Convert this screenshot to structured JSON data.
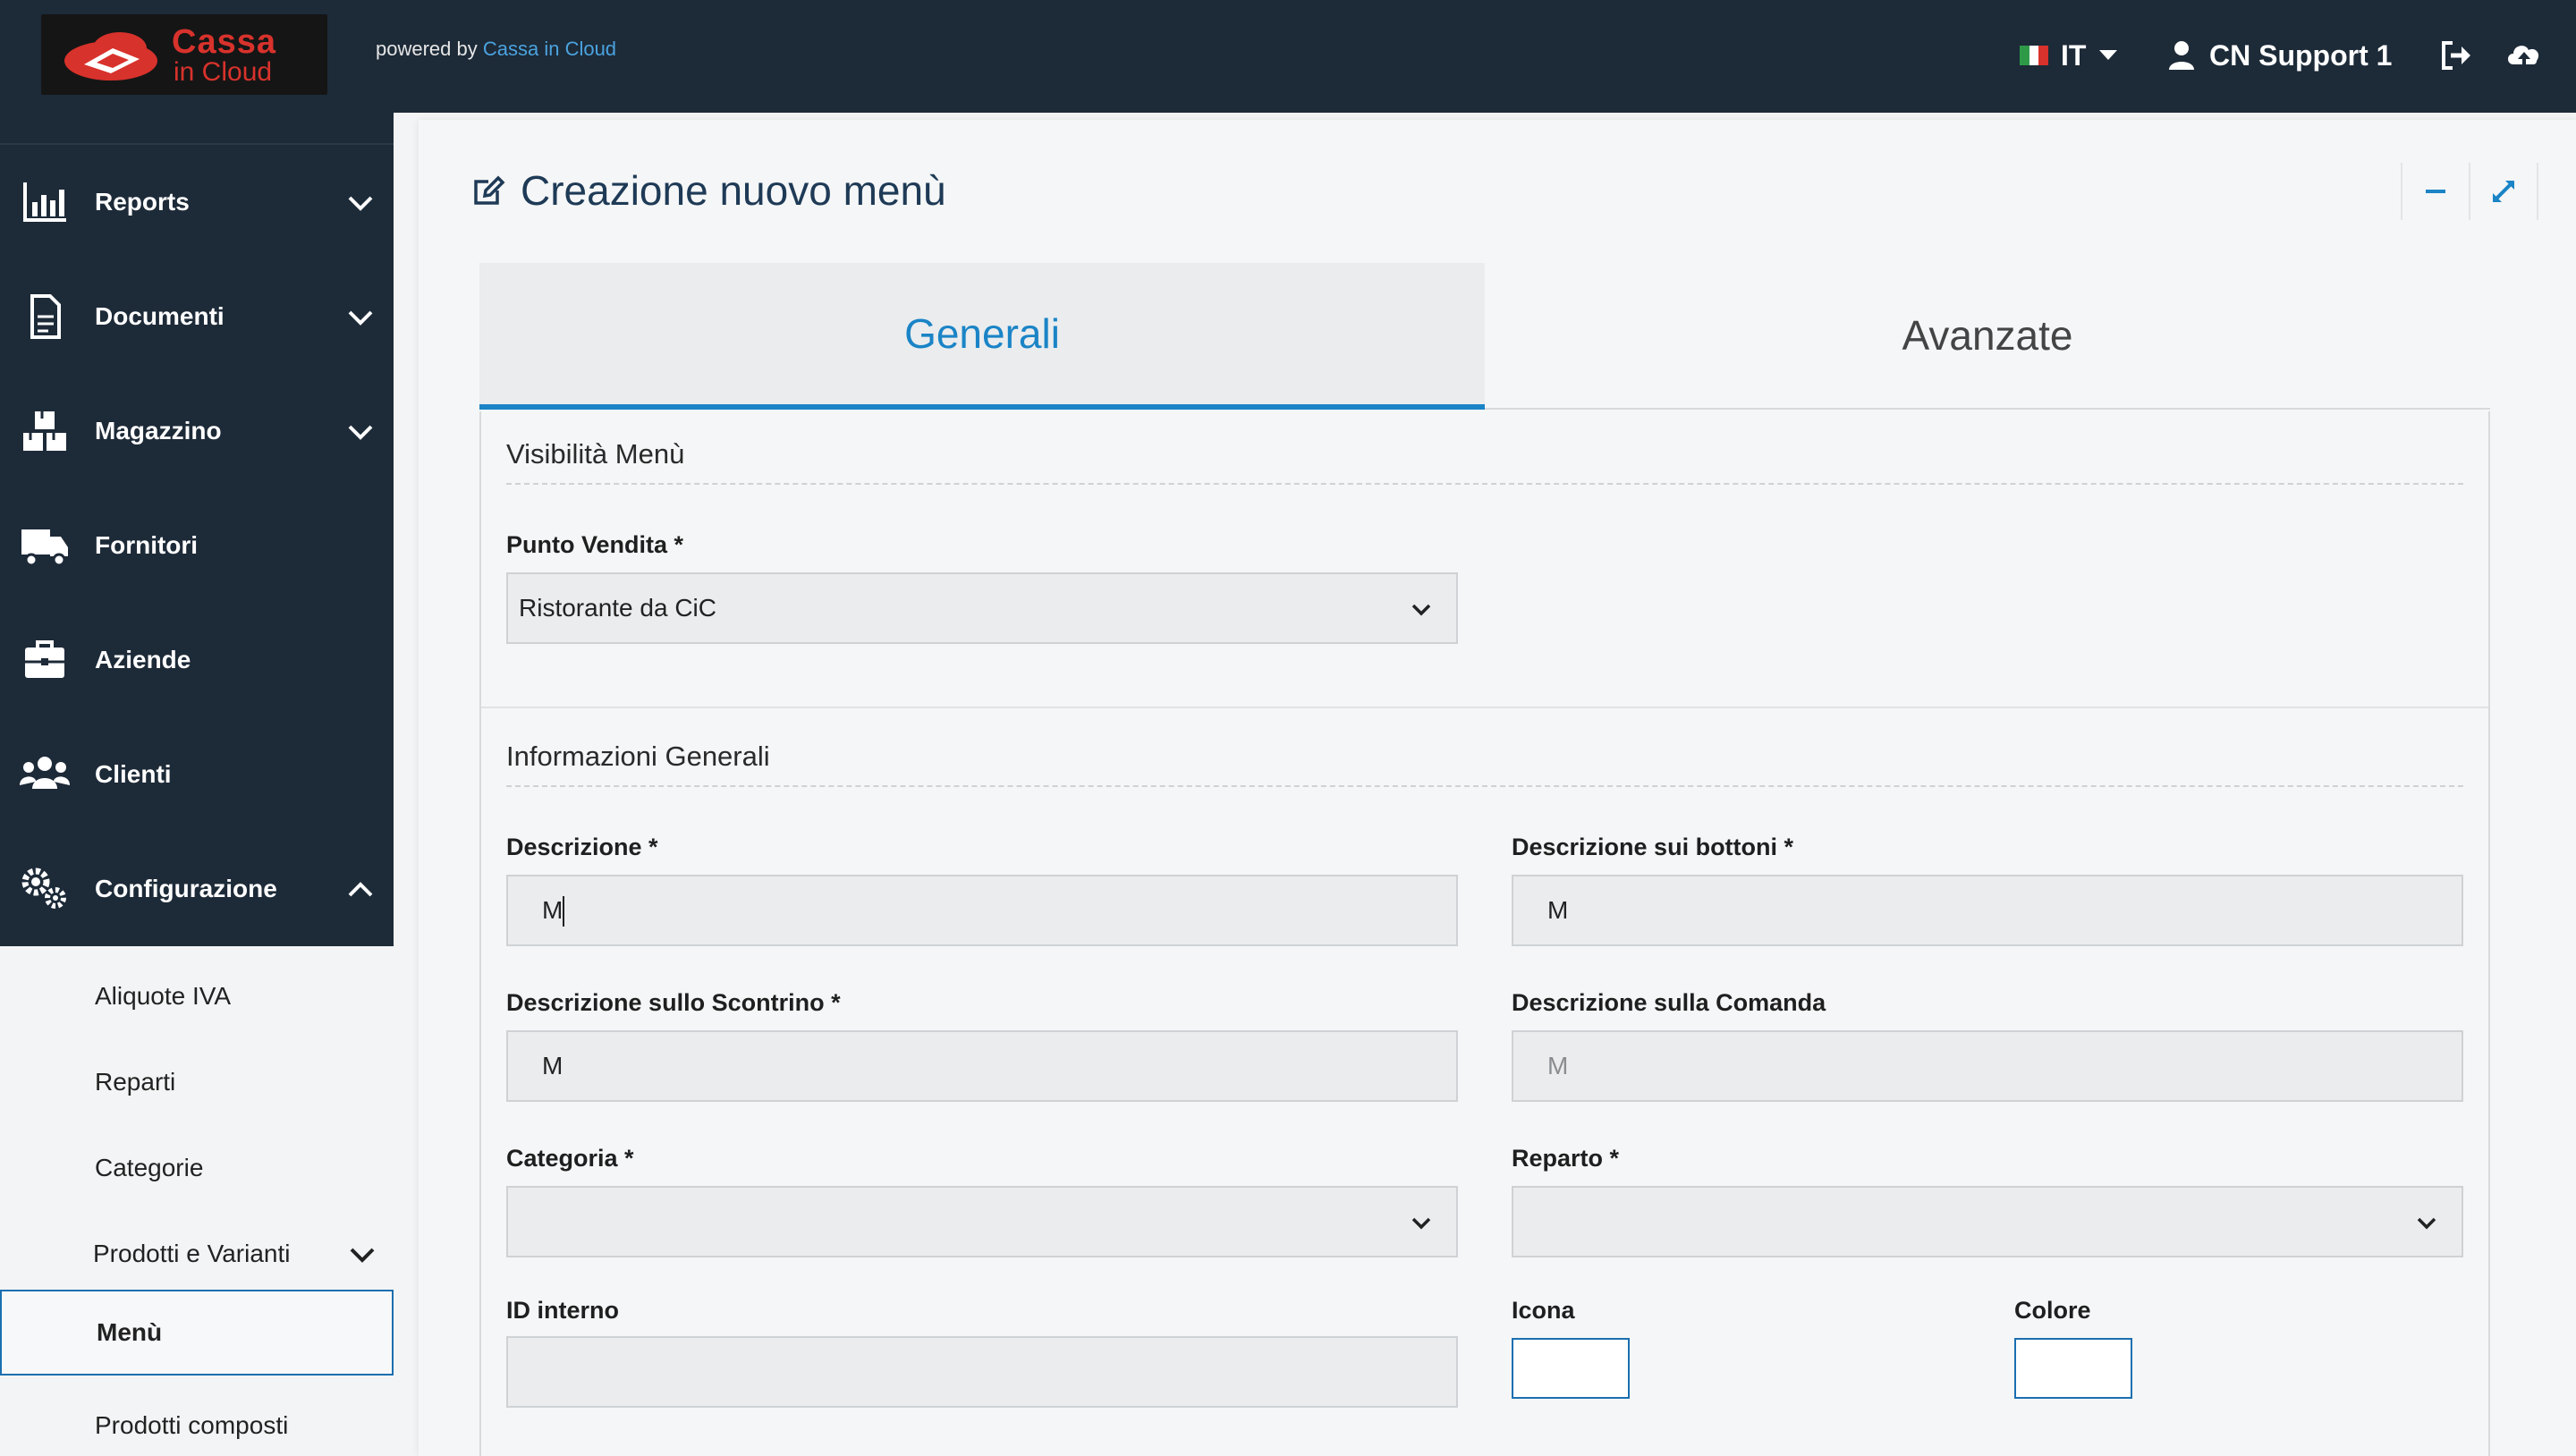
{
  "header": {
    "logo_line1": "Cassa",
    "logo_line2": "in Cloud",
    "powered_prefix": "powered by ",
    "powered_link": "Cassa in Cloud",
    "language": "IT",
    "user_name": "CN Support 1"
  },
  "sidebar": {
    "items": [
      {
        "label": "Reports",
        "icon": "bar-chart-icon"
      },
      {
        "label": "Documenti",
        "icon": "document-icon"
      },
      {
        "label": "Magazzino",
        "icon": "boxes-icon"
      },
      {
        "label": "Fornitori",
        "icon": "truck-icon"
      },
      {
        "label": "Aziende",
        "icon": "briefcase-icon"
      },
      {
        "label": "Clienti",
        "icon": "users-icon"
      },
      {
        "label": "Configurazione",
        "icon": "gears-icon"
      }
    ],
    "submenu": [
      {
        "label": "Aliquote IVA"
      },
      {
        "label": "Reparti"
      },
      {
        "label": "Categorie"
      },
      {
        "label": "Prodotti e Varianti"
      },
      {
        "label": "Menù"
      },
      {
        "label": "Prodotti composti"
      }
    ]
  },
  "page": {
    "title": "Creazione nuovo menù",
    "tabs": [
      {
        "label": "Generali",
        "active": true
      },
      {
        "label": "Avanzate",
        "active": false
      }
    ]
  },
  "form": {
    "section_visibility": "Visibilità Menù",
    "punto_vendita_label": "Punto Vendita *",
    "punto_vendita_value": "Ristorante da CiC",
    "section_general": "Informazioni Generali",
    "descrizione_label": "Descrizione *",
    "descrizione_value": "M",
    "descrizione_bottoni_label": "Descrizione sui bottoni *",
    "descrizione_bottoni_value": "M",
    "descrizione_scontrino_label": "Descrizione sullo Scontrino *",
    "descrizione_scontrino_value": "M",
    "descrizione_comanda_label": "Descrizione sulla Comanda",
    "descrizione_comanda_placeholder": "M",
    "categoria_label": "Categoria *",
    "categoria_value": "",
    "reparto_label": "Reparto *",
    "reparto_value": "",
    "id_interno_label": "ID interno",
    "id_interno_value": "",
    "icona_label": "Icona",
    "colore_label": "Colore"
  },
  "colors": {
    "sidebar_bg": "#1d2a38",
    "accent": "#1a84c6",
    "brand_red": "#d8322c"
  }
}
